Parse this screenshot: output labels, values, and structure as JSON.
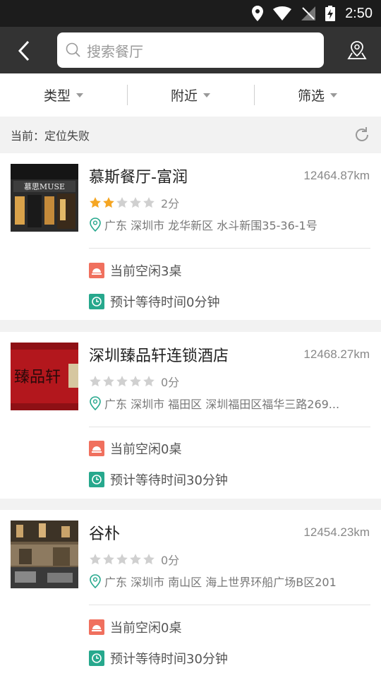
{
  "status_bar": {
    "time": "2:50",
    "icons": [
      "location-icon",
      "wifi-icon",
      "no-signal-icon",
      "battery-charging-icon"
    ]
  },
  "header": {
    "search_placeholder": "搜索餐厅",
    "back_icon": "chevron-left-icon",
    "map_icon": "map-pin-icon"
  },
  "filters": [
    {
      "label": "类型"
    },
    {
      "label": "附近"
    },
    {
      "label": "筛选"
    }
  ],
  "location": {
    "text": "当前：定位失败",
    "refresh_icon": "refresh-icon"
  },
  "restaurants": [
    {
      "name": "慕斯餐厅-富润",
      "distance": "12464.87km",
      "stars": 2,
      "score": "2分",
      "address": "广东 深圳市 龙华新区 水斗新围35-36-1号",
      "free_tables": "当前空闲3桌",
      "wait_time": "预计等待时间0分钟",
      "thumb_text": "慕思MUSE"
    },
    {
      "name": "深圳臻品轩连锁酒店",
      "distance": "12468.27km",
      "stars": 0,
      "score": "0分",
      "address": "广东 深圳市 福田区 深圳福田区福华三路269...",
      "free_tables": "当前空闲0桌",
      "wait_time": "预计等待时间30分钟",
      "thumb_text": "臻品轩"
    },
    {
      "name": "谷朴",
      "distance": "12454.23km",
      "stars": 0,
      "score": "0分",
      "address": "广东 深圳市 南山区 海上世界环船广场B区201",
      "free_tables": "当前空闲0桌",
      "wait_time": "预计等待时间30分钟"
    }
  ],
  "colors": {
    "header": "#333333",
    "star_filled": "#f5a623",
    "star_empty": "#d0d0d0",
    "free_icon": "#f0705e",
    "wait_icon": "#27a88d"
  }
}
